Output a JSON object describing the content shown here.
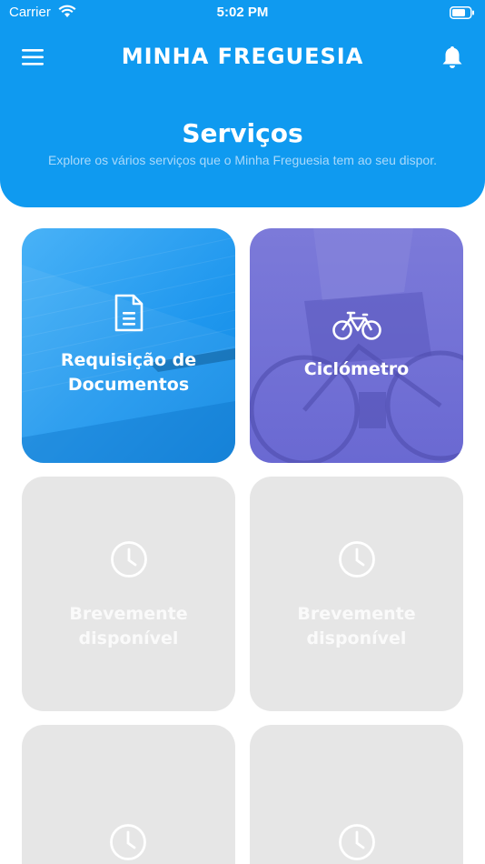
{
  "status_bar": {
    "carrier": "Carrier",
    "time": "5:02 PM"
  },
  "header": {
    "app_title": "MINHA FREGUESIA",
    "page_title": "Serviços",
    "page_subtitle": "Explore os vários serviços que o Minha Freguesia tem ao seu dispor."
  },
  "icons": {
    "menu": "menu-icon",
    "notifications": "bell-icon",
    "documents": "document-icon",
    "cyclometer": "bicycle-icon",
    "coming_soon": "clock-icon"
  },
  "cards": [
    {
      "label_line1": "Requisição de",
      "label_line2": "Documentos"
    },
    {
      "label_line1": "Ciclómetro",
      "label_line2": ""
    },
    {
      "label_line1": "Brevemente",
      "label_line2": "disponível"
    },
    {
      "label_line1": "Brevemente",
      "label_line2": "disponível"
    },
    {
      "label_line1": "",
      "label_line2": ""
    },
    {
      "label_line1": "",
      "label_line2": ""
    }
  ],
  "colors": {
    "primary": "#0f9af0",
    "cyclometer_card": "#6f6ed6",
    "disabled_card": "#e6e6e6"
  }
}
